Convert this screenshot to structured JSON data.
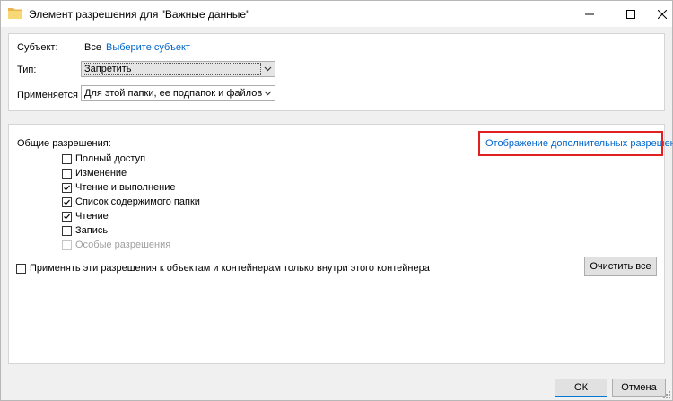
{
  "window": {
    "title": "Элемент разрешения для \"Важные данные\"",
    "title_icon": "folder-icon",
    "controls": {
      "minimize": "—",
      "maximize": "☐",
      "close": "✕"
    }
  },
  "principal": {
    "label": "Субъект:",
    "value": "Все",
    "select_link": "Выберите субъект"
  },
  "type": {
    "label": "Тип:",
    "value": "Запретить"
  },
  "applies_to": {
    "label": "Применяется к:",
    "value": "Для этой папки, ее подпапок и файлов"
  },
  "permissions": {
    "heading": "Общие разрешения:",
    "advanced_link": "Отображение дополнительных разрешений",
    "items": [
      {
        "label": "Полный доступ",
        "checked": false,
        "enabled": true
      },
      {
        "label": "Изменение",
        "checked": false,
        "enabled": true
      },
      {
        "label": "Чтение и выполнение",
        "checked": true,
        "enabled": true
      },
      {
        "label": "Список содержимого папки",
        "checked": true,
        "enabled": true
      },
      {
        "label": "Чтение",
        "checked": true,
        "enabled": true
      },
      {
        "label": "Запись",
        "checked": false,
        "enabled": true
      },
      {
        "label": "Особые разрешения",
        "checked": false,
        "enabled": false
      }
    ]
  },
  "apply_inside": {
    "label": "Применять эти разрешения к объектам и контейнерам только внутри этого контейнера",
    "checked": false
  },
  "buttons": {
    "clear_all": "Очистить все",
    "ok": "ОК",
    "cancel": "Отмена"
  },
  "colors": {
    "link": "#0066cc",
    "highlight": "#e32020",
    "accent": "#0078d7"
  }
}
